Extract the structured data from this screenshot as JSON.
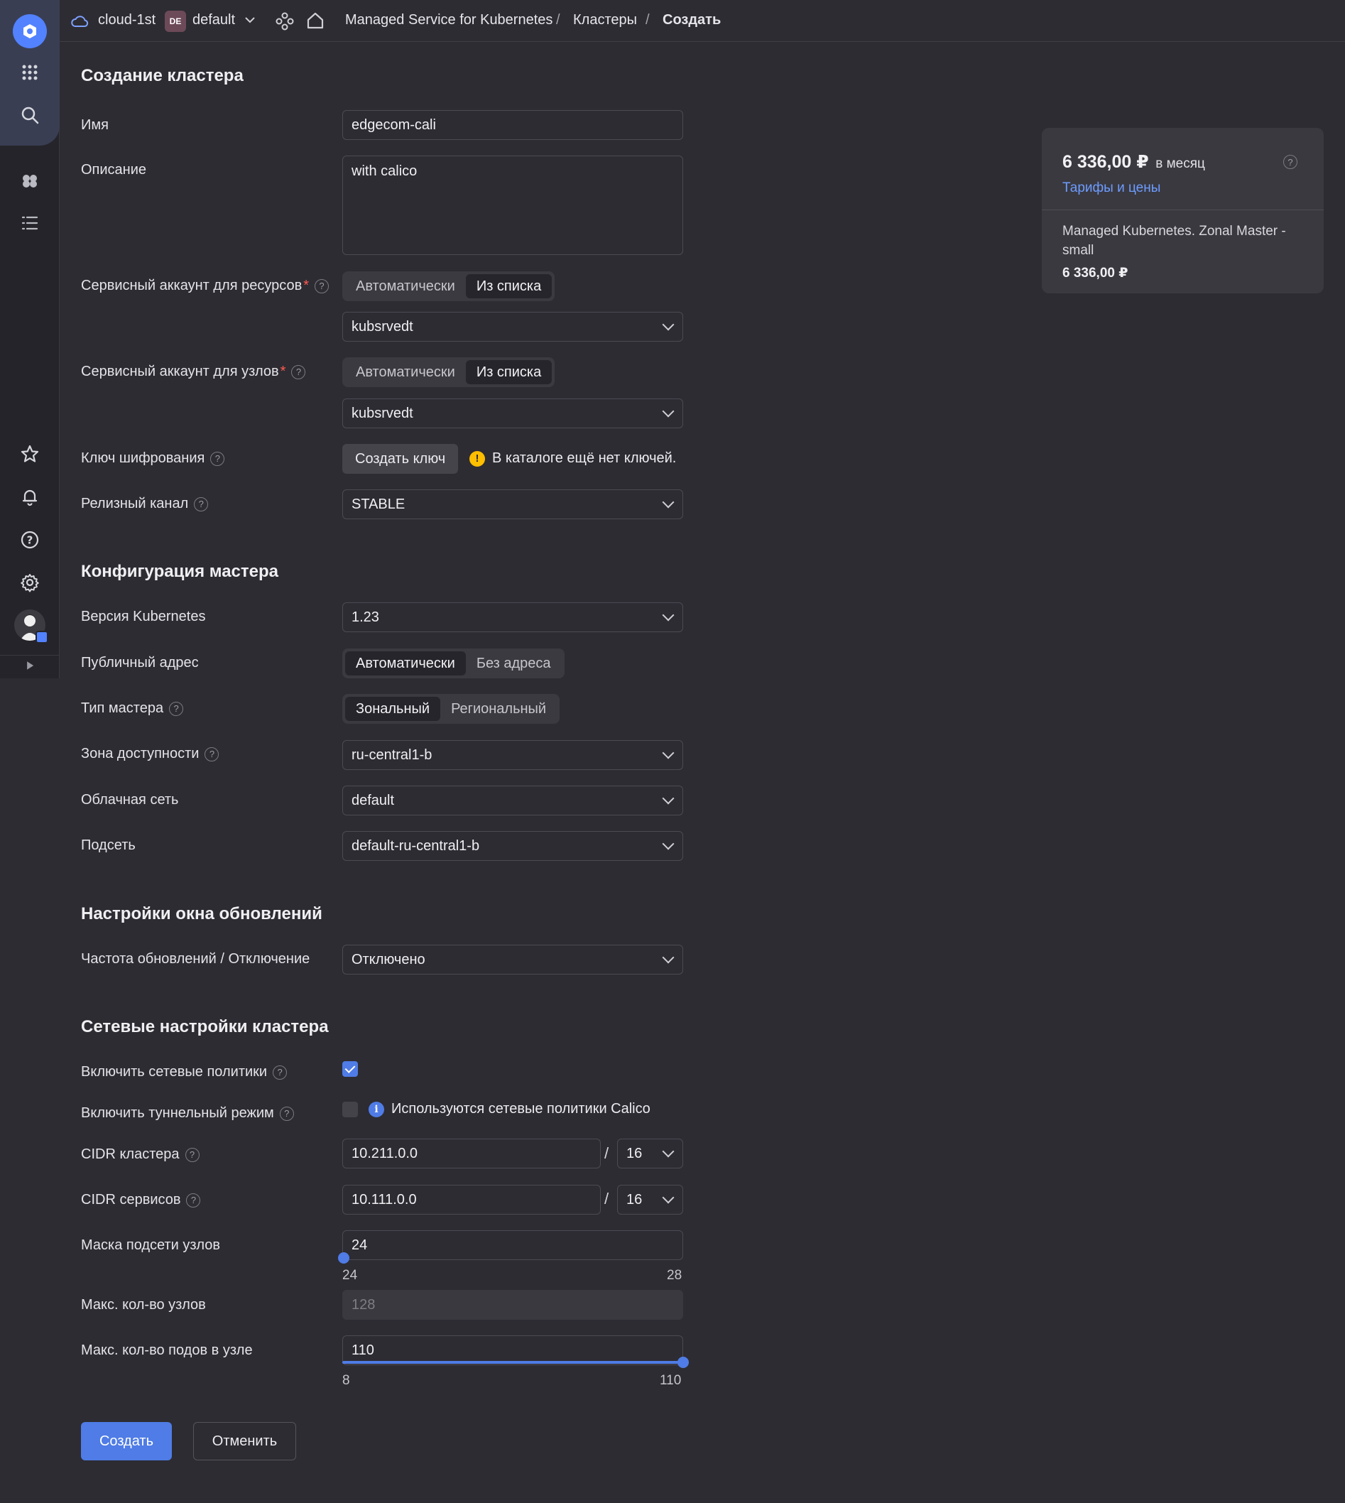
{
  "sidebar": {
    "icons": [
      "logo-icon",
      "apps-grid-icon",
      "search-icon",
      "services-icon",
      "tasks-list-icon",
      "star-icon",
      "bell-icon",
      "help-icon",
      "settings-icon",
      "user-avatar",
      "expand-icon"
    ]
  },
  "topbar": {
    "cloud": "cloud-1st",
    "folder_badge": "DE",
    "folder": "default",
    "breadcrumbs": [
      "Managed Service for Kubernetes",
      "Кластеры",
      "Создать"
    ],
    "separator": "/"
  },
  "form": {
    "title": "Создание кластера",
    "name_label": "Имя",
    "name_value": "edgecom-cali",
    "description_label": "Описание",
    "description_value": "with calico",
    "sa_resources_label": "Сервисный аккаунт для ресурсов",
    "sa_nodes_label": "Сервисный аккаунт для узлов",
    "required_mark": "*",
    "help_mark": "?",
    "mode_auto": "Автоматически",
    "mode_list": "Из списка",
    "sa_resources_value": "kubsrvedt",
    "sa_nodes_value": "kubsrvedt",
    "encryption_label": "Ключ шифрования",
    "create_key_button": "Создать ключ",
    "warn_mark": "!",
    "no_keys_note": "В каталоге ещё нет ключей.",
    "release_channel_label": "Релизный канал",
    "release_channel_value": "STABLE"
  },
  "master": {
    "title": "Конфигурация мастера",
    "k8s_version_label": "Версия Kubernetes",
    "k8s_version_value": "1.23",
    "public_address_label": "Публичный адрес",
    "public_auto": "Автоматически",
    "public_none": "Без адреса",
    "master_type_label": "Тип мастера",
    "type_zonal": "Зональный",
    "type_regional": "Региональный",
    "zone_label": "Зона доступности",
    "zone_value": "ru-central1-b",
    "network_label": "Облачная сеть",
    "network_value": "default",
    "subnet_label": "Подсеть",
    "subnet_value": "default-ru-central1-b"
  },
  "updates": {
    "title": "Настройки окна обновлений",
    "frequency_label": "Частота обновлений / Отключение",
    "frequency_value": "Отключено"
  },
  "network": {
    "title": "Сетевые настройки кластера",
    "policies_label": "Включить сетевые политики",
    "policies_checked": true,
    "tunnel_label": "Включить туннельный режим",
    "tunnel_checked": false,
    "info_mark": "i",
    "calico_note": "Используются сетевые политики Calico",
    "cidr_cluster_label": "CIDR кластера",
    "cidr_cluster_ip": "10.211.0.0",
    "cidr_cluster_mask": "16",
    "cidr_services_label": "CIDR сервисов",
    "cidr_services_ip": "10.111.0.0",
    "cidr_services_mask": "16",
    "slash": "/",
    "node_mask_label": "Маска подсети узлов",
    "node_mask_value": "24",
    "node_mask_min": "24",
    "node_mask_max": "28",
    "max_nodes_label": "Макс. кол-во узлов",
    "max_nodes_value": "128",
    "max_pods_label": "Макс. кол-во подов в узле",
    "max_pods_value": "110",
    "max_pods_min": "8",
    "max_pods_max": "110"
  },
  "actions": {
    "create": "Создать",
    "cancel": "Отменить"
  },
  "price": {
    "amount": "6 336,00 ₽",
    "period": "в месяц",
    "help_mark": "?",
    "tariffs_link": "Тарифы и цены",
    "item_name": "Managed Kubernetes. Zonal Master - small",
    "item_price": "6 336,00 ₽"
  },
  "colors": {
    "accent": "#4f7ce6",
    "link": "#6d9cff",
    "warning": "#ffbe00",
    "required": "#ff5a4f",
    "background": "#2d2c33"
  }
}
